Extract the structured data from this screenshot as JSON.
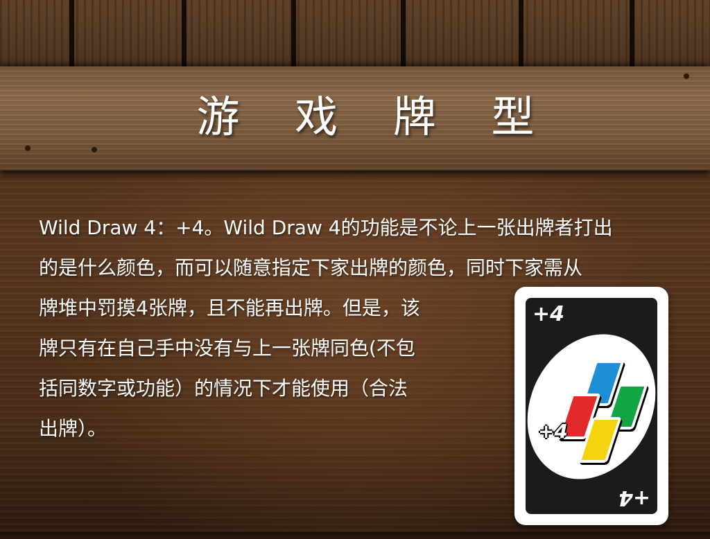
{
  "title": "游 戏 牌 型",
  "description_lines": [
    "Wild Draw 4：+4。Wild Draw 4的功能是不论上一张出牌者打出",
    "的是什么颜色，而可以随意指定下家出牌的颜色，同时下家需从",
    "牌堆中罚摸4张牌，且不能再出牌。但是，该",
    "牌只有在自己手中没有与上一张牌同色(不包",
    "括同数字或功能）的情况下才能使用（合法",
    "出牌）。"
  ],
  "card": {
    "corner_label": "+4",
    "center_label": "+4",
    "mini_card_colors": [
      "#1e8fd6",
      "#12a544",
      "#e32a2a",
      "#f5d40f"
    ],
    "border_color": "#ffffff",
    "inner_color": "#1b1b1b"
  }
}
